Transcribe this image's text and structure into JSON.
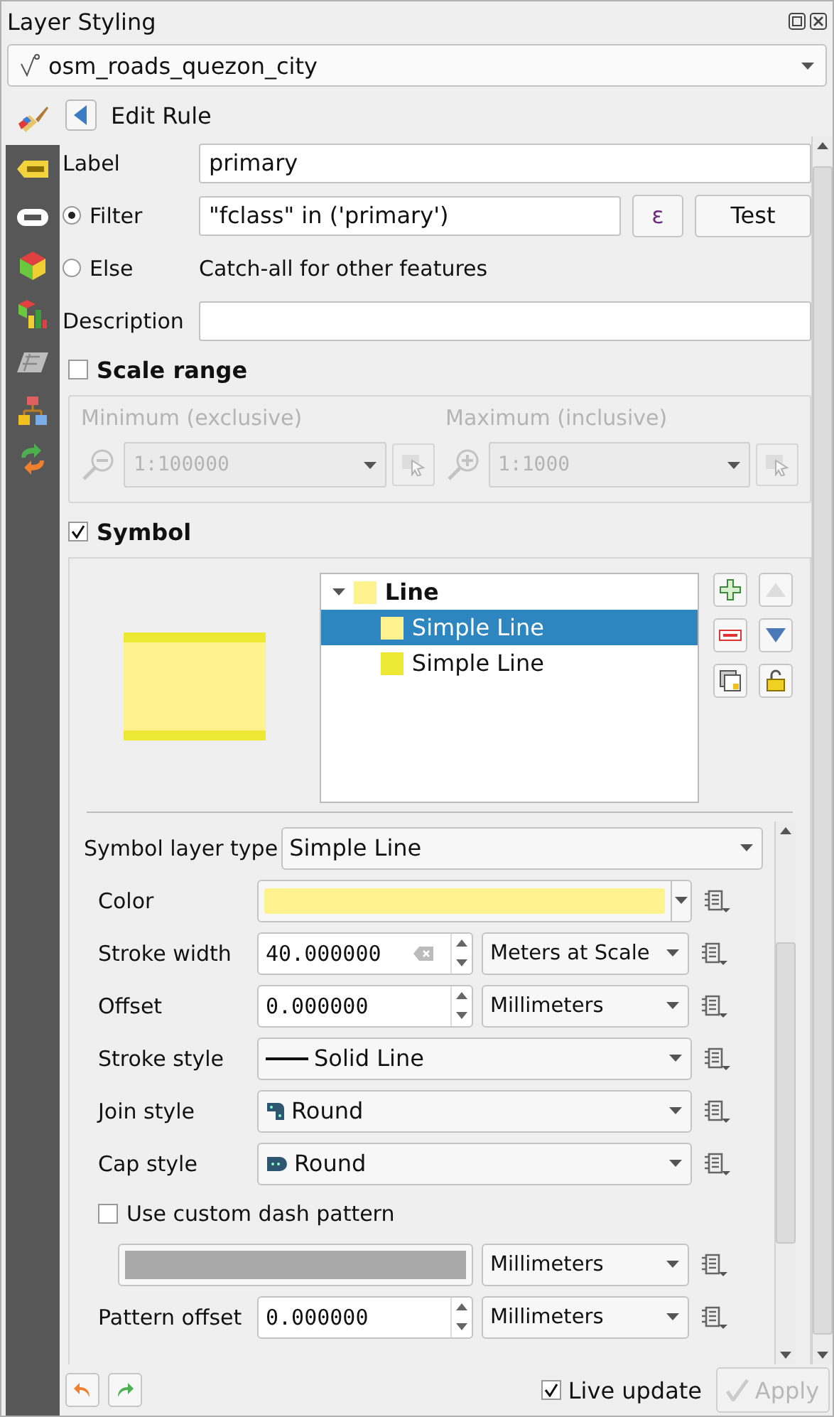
{
  "window": {
    "title": "Layer Styling"
  },
  "layer_select": {
    "value": "osm_roads_quezon_city"
  },
  "side_tabs": [
    {
      "kind": "brush",
      "selected": true
    },
    {
      "kind": "label",
      "selected": false
    },
    {
      "kind": "abc",
      "selected": false
    },
    {
      "kind": "cube",
      "selected": false
    },
    {
      "kind": "diagram",
      "selected": false
    },
    {
      "kind": "map",
      "selected": false
    },
    {
      "kind": "tree",
      "selected": false
    },
    {
      "kind": "history",
      "selected": false
    }
  ],
  "header": {
    "title": "Edit Rule"
  },
  "rule": {
    "label_caption": "Label",
    "label_value": "primary",
    "filter": {
      "caption": "Filter",
      "selected": true,
      "value": "\"fclass\" in ('primary')",
      "expression_button": "ε",
      "test_button": "Test"
    },
    "else": {
      "caption": "Else",
      "selected": false,
      "note": "Catch-all for other features"
    },
    "description_caption": "Description"
  },
  "scale_range": {
    "title": "Scale range",
    "checked": false,
    "disabled": true,
    "minimum": {
      "caption": "Minimum (exclusive)",
      "value": "1:100000"
    },
    "maximum": {
      "caption": "Maximum (inclusive)",
      "value": "1:1000"
    }
  },
  "symbol": {
    "title": "Symbol",
    "checked": true,
    "tree": [
      {
        "label": "Line",
        "color": "#fef28f",
        "selected": false,
        "expanded": true,
        "children": [
          {
            "label": "Simple Line",
            "color": "#fef28f",
            "selected": true
          },
          {
            "label": "Simple Line",
            "color": "#ede833",
            "selected": false
          }
        ]
      }
    ]
  },
  "layer_type": {
    "caption": "Symbol layer type",
    "value": "Simple Line"
  },
  "properties": [
    {
      "kind": "color",
      "label": "Color",
      "color": "#fef28f"
    },
    {
      "kind": "spin",
      "label": "Stroke width",
      "value": "40.000000",
      "clearable": true,
      "unit": "Meters at Scale"
    },
    {
      "kind": "spin",
      "label": "Offset",
      "value": "0.000000",
      "unit": "Millimeters"
    },
    {
      "kind": "combo",
      "label": "Stroke style",
      "value": "Solid Line"
    },
    {
      "kind": "combo",
      "label": "Join style",
      "value": "Round"
    },
    {
      "kind": "combo",
      "label": "Cap style",
      "value": "Round"
    },
    {
      "kind": "check",
      "label": "Use custom dash pattern",
      "checked": false
    },
    {
      "kind": "dash",
      "unit": "Millimeters"
    },
    {
      "kind": "spin",
      "label": "Pattern offset",
      "value": "0.000000",
      "unit": "Millimeters"
    }
  ],
  "footer": {
    "live_update": {
      "label": "Live update",
      "checked": true
    },
    "apply": {
      "label": "Apply",
      "disabled": true
    }
  }
}
